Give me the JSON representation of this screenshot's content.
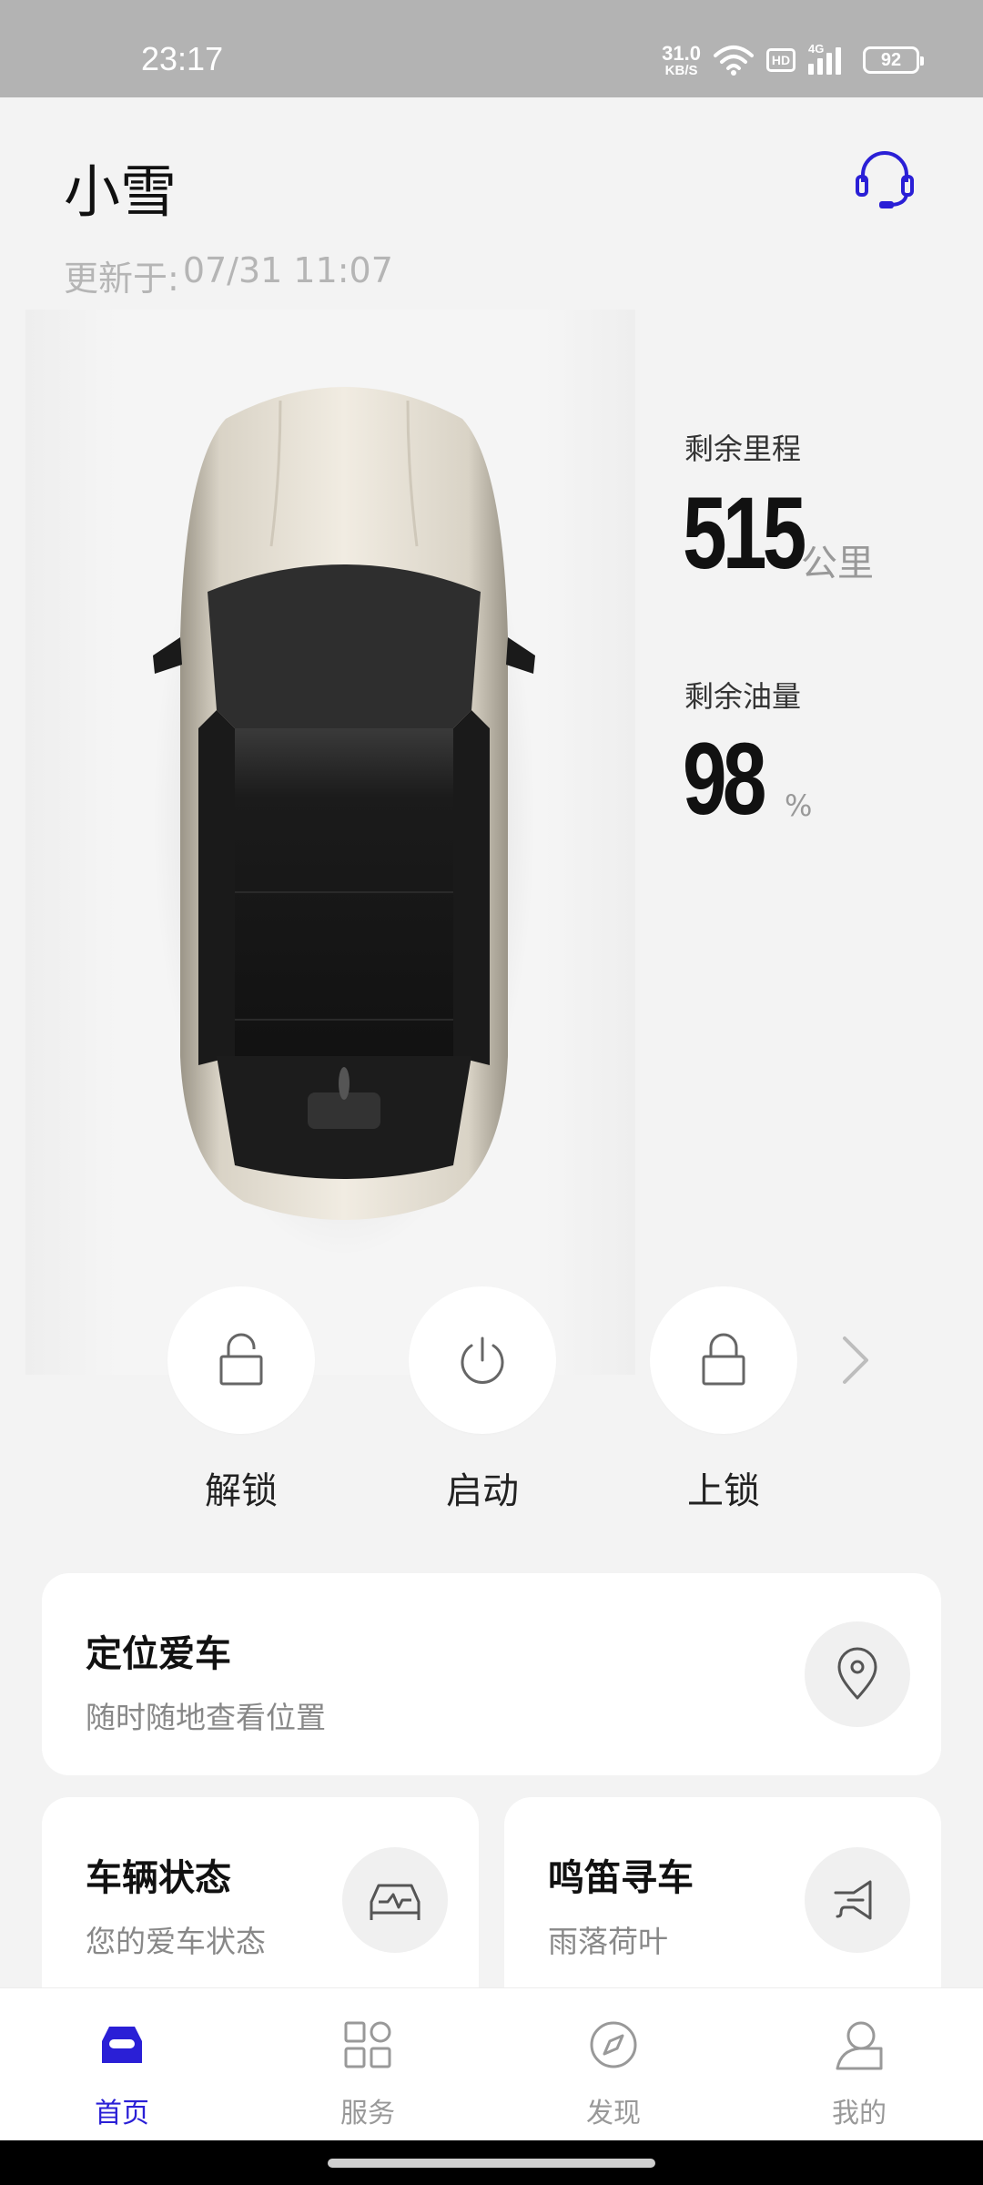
{
  "status_bar": {
    "time": "23:17",
    "net_speed_value": "31.0",
    "net_speed_unit": "KB/S",
    "hd": "HD",
    "network": "4G",
    "battery": "92"
  },
  "header": {
    "car_name": "小雪",
    "update_label": "更新于:",
    "update_time": "07/31 11:07",
    "support_icon": "headset-icon"
  },
  "stats": {
    "range_label": "剩余里程",
    "range_value": "515",
    "range_unit": "公里",
    "fuel_label": "剩余油量",
    "fuel_value": "98",
    "fuel_unit": "%"
  },
  "actions": [
    {
      "label": "解锁",
      "icon": "unlock-icon"
    },
    {
      "label": "启动",
      "icon": "power-icon"
    },
    {
      "label": "上锁",
      "icon": "lock-icon"
    }
  ],
  "cards": {
    "locate": {
      "title": "定位爱车",
      "subtitle": "随时随地查看位置",
      "icon": "location-pin-icon"
    },
    "status": {
      "title": "车辆状态",
      "subtitle": "您的爱车状态",
      "icon": "car-status-icon"
    },
    "honk": {
      "title": "鸣笛寻车",
      "subtitle": "雨落荷叶",
      "icon": "horn-icon"
    }
  },
  "nav": [
    {
      "label": "首页",
      "icon": "home-car-icon",
      "active": true
    },
    {
      "label": "服务",
      "icon": "grid-icon",
      "active": false
    },
    {
      "label": "发现",
      "icon": "compass-icon",
      "active": false
    },
    {
      "label": "我的",
      "icon": "profile-icon",
      "active": false
    }
  ],
  "colors": {
    "accent": "#2a1fd6",
    "background": "#f3f3f3",
    "status_bar": "#b3b3b3"
  }
}
